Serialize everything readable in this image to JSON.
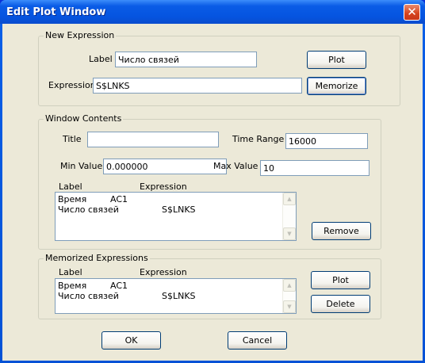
{
  "window": {
    "title": "Edit Plot Window",
    "close_icon": "close-icon",
    "close_glyph": "✕"
  },
  "new_expression": {
    "group_label": "New Expression",
    "label_caption": "Label",
    "label_value": "Число связей",
    "expression_caption": "Expression",
    "expression_value": "S$LNKS",
    "plot_button": "Plot",
    "memorize_button": "Memorize"
  },
  "window_contents": {
    "group_label": "Window Contents",
    "title_caption": "Title",
    "title_value": "",
    "time_range_caption": "Time Range",
    "time_range_value": "16000",
    "min_value_caption": "Min Value",
    "min_value_value": "0.000000",
    "max_value_caption": "Max Value",
    "max_value_value": "10",
    "col_label": "Label",
    "col_expression": "Expression",
    "rows": [
      {
        "label": "Время",
        "expression": "AC1"
      },
      {
        "label": "Число связей",
        "expression": "S$LNKS"
      }
    ],
    "remove_button": "Remove"
  },
  "memorized": {
    "group_label": "Memorized Expressions",
    "col_label": "Label",
    "col_expression": "Expression",
    "rows": [
      {
        "label": "Время",
        "expression": "AC1"
      },
      {
        "label": "Число связей",
        "expression": "S$LNKS"
      }
    ],
    "plot_button": "Plot",
    "delete_button": "Delete"
  },
  "footer": {
    "ok_button": "OK",
    "cancel_button": "Cancel"
  },
  "scroll_glyphs": {
    "up": "▲",
    "down": "▼"
  },
  "colors": {
    "titlebar": "#0554e0",
    "dialog_face": "#ece9d8",
    "field_border": "#7f9db9",
    "close_button": "#d5421c"
  }
}
